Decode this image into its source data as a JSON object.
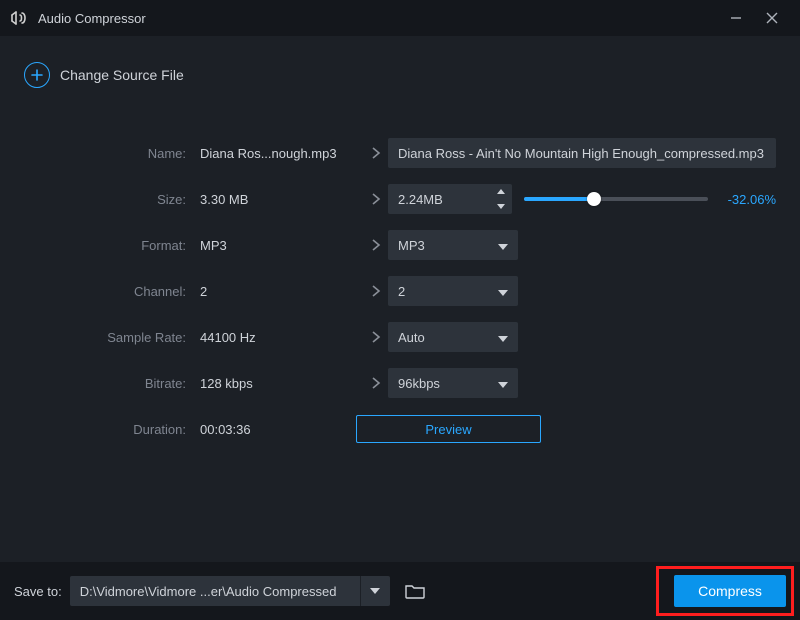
{
  "titlebar": {
    "title": "Audio Compressor"
  },
  "source": {
    "change_label": "Change Source File"
  },
  "labels": {
    "name": "Name:",
    "size": "Size:",
    "format": "Format:",
    "channel": "Channel:",
    "sample_rate": "Sample Rate:",
    "bitrate": "Bitrate:",
    "duration": "Duration:"
  },
  "original": {
    "name": "Diana Ros...nough.mp3",
    "size": "3.30 MB",
    "format": "MP3",
    "channel": "2",
    "sample_rate": "44100 Hz",
    "bitrate": "128 kbps",
    "duration": "00:03:36"
  },
  "output": {
    "name": "Diana Ross - Ain't No Mountain High Enough_compressed.mp3",
    "size": "2.24MB",
    "size_percent_text": "-32.06%",
    "slider_fill_pct": 38,
    "format": "MP3",
    "channel": "2",
    "sample_rate": "Auto",
    "bitrate": "96kbps"
  },
  "preview": {
    "label": "Preview"
  },
  "bottombar": {
    "saveto_label": "Save to:",
    "path": "D:\\Vidmore\\Vidmore ...er\\Audio Compressed",
    "compress_label": "Compress"
  }
}
